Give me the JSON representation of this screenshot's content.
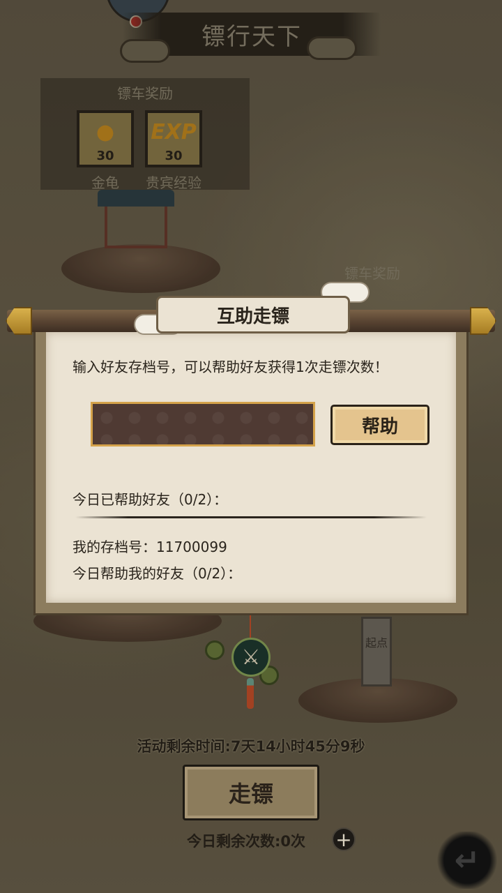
{
  "header": {
    "title": "镖行天下"
  },
  "rewards_left": {
    "title": "镖车奖励",
    "items": [
      {
        "icon": "golden-turtle-icon",
        "quantity": "30",
        "label": "金龟"
      },
      {
        "icon": "exp-icon",
        "glyph": "EXP",
        "quantity": "30",
        "label": "贵宾经验"
      }
    ]
  },
  "rewards_right": {
    "title": "镖车奖励"
  },
  "scene": {
    "stele_text": "起点"
  },
  "dialog": {
    "title": "互助走镖",
    "description": "输入好友存档号，可以帮助好友获得1次走镖次数！",
    "input": {
      "value": "",
      "placeholder": ""
    },
    "help_button_label": "帮助",
    "helped_today_label": "今日已帮助好友（0/2）：",
    "my_save_id_label": "我的存档号：11700099",
    "friends_helped_me_label": "今日帮助我的好友（0/2）："
  },
  "footer": {
    "timer_text": "活动剩余时间:7天14小时45分9秒",
    "go_button_label": "走镖",
    "remaining_text": "今日剩余次数:0次",
    "plus_icon": "plus-icon",
    "back_icon": "back-arrow-icon"
  },
  "colors": {
    "parchment": "#ebe3d3",
    "input_border": "#d4a24a",
    "help_button": "#e4c48e",
    "rod_gold": "#d9b14c"
  }
}
